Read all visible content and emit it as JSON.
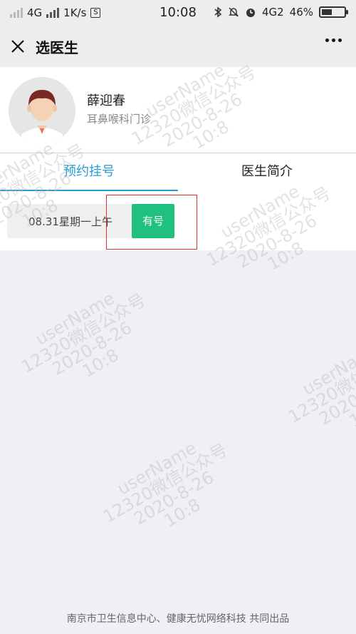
{
  "status": {
    "network_left": "4G",
    "network_mid": "4G",
    "speed": "1K/s",
    "s_badge": "S",
    "time": "10:08",
    "network_right": "4G2",
    "battery": "46%",
    "battery_level": 0.46
  },
  "nav": {
    "title": "选医生",
    "close_icon": "close-icon",
    "more_icon": "more-icon"
  },
  "doctor": {
    "name": "薛迎春",
    "dept": "耳鼻喉科门诊"
  },
  "tabs": [
    {
      "label": "预约挂号",
      "active": true
    },
    {
      "label": "医生简介",
      "active": false
    }
  ],
  "schedule": [
    {
      "date": "08.31星期一上午",
      "status": "有号"
    }
  ],
  "watermark": {
    "line1": "userName",
    "line2": "12320微信公众号",
    "line3": "2020-8-26",
    "line4": "10:8"
  },
  "footer": "南京市卫生信息中心、健康无忧网络科技 共同出品",
  "colors": {
    "accent": "#2b9bd1",
    "available": "#20c080",
    "highlight": "#e03030"
  }
}
